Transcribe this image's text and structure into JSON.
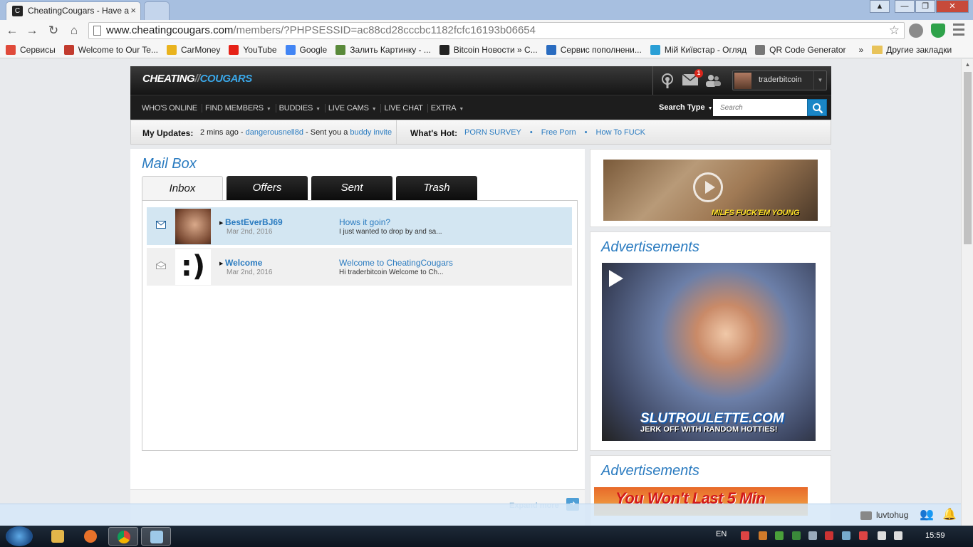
{
  "browser": {
    "tab_title": "CheatingCougars - Have a",
    "favicon_text": "C",
    "tab_close": "×",
    "url_domain": "www.cheatingcougars.com",
    "url_path": "/members/?PHPSESSID=ac88cd28cccbc1182fcfc16193b06654",
    "window_controls": {
      "minimize": "—",
      "maximize": "❐",
      "close": "✕",
      "user": "▲"
    },
    "nav": {
      "back": "←",
      "forward": "→",
      "reload": "↻",
      "home": "⌂",
      "star": "☆"
    },
    "bookmarks": [
      {
        "label": "Сервисы",
        "color": "#e04a3a"
      },
      {
        "label": "Welcome to Our Te...",
        "color": "#c23b2e"
      },
      {
        "label": "CarMoney",
        "color": "#e9b31e"
      },
      {
        "label": "YouTube",
        "color": "#e62117"
      },
      {
        "label": "Google",
        "color": "#4285f4"
      },
      {
        "label": "Залить Картинку - ...",
        "color": "#5a8a3a"
      },
      {
        "label": "Bitcoin Новости » С...",
        "color": "#222222"
      },
      {
        "label": "Сервис пополнени...",
        "color": "#2a6cc0"
      },
      {
        "label": "Мій Київстар - Огляд",
        "color": "#2a9fd6"
      },
      {
        "label": "QR Code Generator",
        "color": "#777777"
      }
    ],
    "bookmarks_more": "»",
    "other_bookmarks": "Другие закладки"
  },
  "site": {
    "logo": {
      "part1": "CHEATING",
      "sep": "//",
      "part2": "COUGARS"
    },
    "notification_count": "1",
    "username": "traderbitcoin",
    "nav_items": [
      "WHO'S ONLINE",
      "FIND MEMBERS",
      "BUDDIES",
      "LIVE CAMS",
      "LIVE CHAT",
      "EXTRA"
    ],
    "nav_carets": [
      false,
      true,
      true,
      true,
      false,
      true
    ],
    "search_type_label": "Search Type",
    "search_placeholder": "Search",
    "updates": {
      "label": "My Updates:",
      "time": "2 mins ago - ",
      "user": "dangerousnell8d",
      "action": " - Sent you a ",
      "link": "buddy invite"
    },
    "whats_hot": {
      "label": "What's Hot:",
      "links": [
        "PORN SURVEY",
        "Free Porn",
        "How To FUCK"
      ]
    }
  },
  "mailbox": {
    "title": "Mail Box",
    "tabs": [
      "Inbox",
      "Offers",
      "Sent",
      "Trash"
    ],
    "active_tab": "Inbox",
    "messages": [
      {
        "sender": "BestEverBJ69",
        "date": "Mar 2nd, 2016",
        "subject": "Hows it goin?",
        "preview": "I just wanted to drop by and sa...",
        "unread": true
      },
      {
        "sender": "Welcome",
        "date": "Mar 2nd, 2016",
        "subject": "Welcome to CheatingCougars",
        "preview": "Hi traderbitcoin Welcome to Ch...",
        "unread": false
      }
    ],
    "smiley_text": ":)",
    "expand_label": "Expand more"
  },
  "sidebar": {
    "ad1_caption": "MILFS FUCK'EM YOUNG",
    "ad_section_title_1": "Advertisements",
    "ad2_brand": "SLUTROULETTE.COM",
    "ad2_tagline": "JERK OFF WITH RANDOM HOTTIES!",
    "ad_section_title_2": "Advertisements",
    "ad3_text": "You Won't Last 5 Min"
  },
  "chat": {
    "username": "luvtohug"
  },
  "taskbar": {
    "lang": "EN",
    "clock": "15:59"
  }
}
